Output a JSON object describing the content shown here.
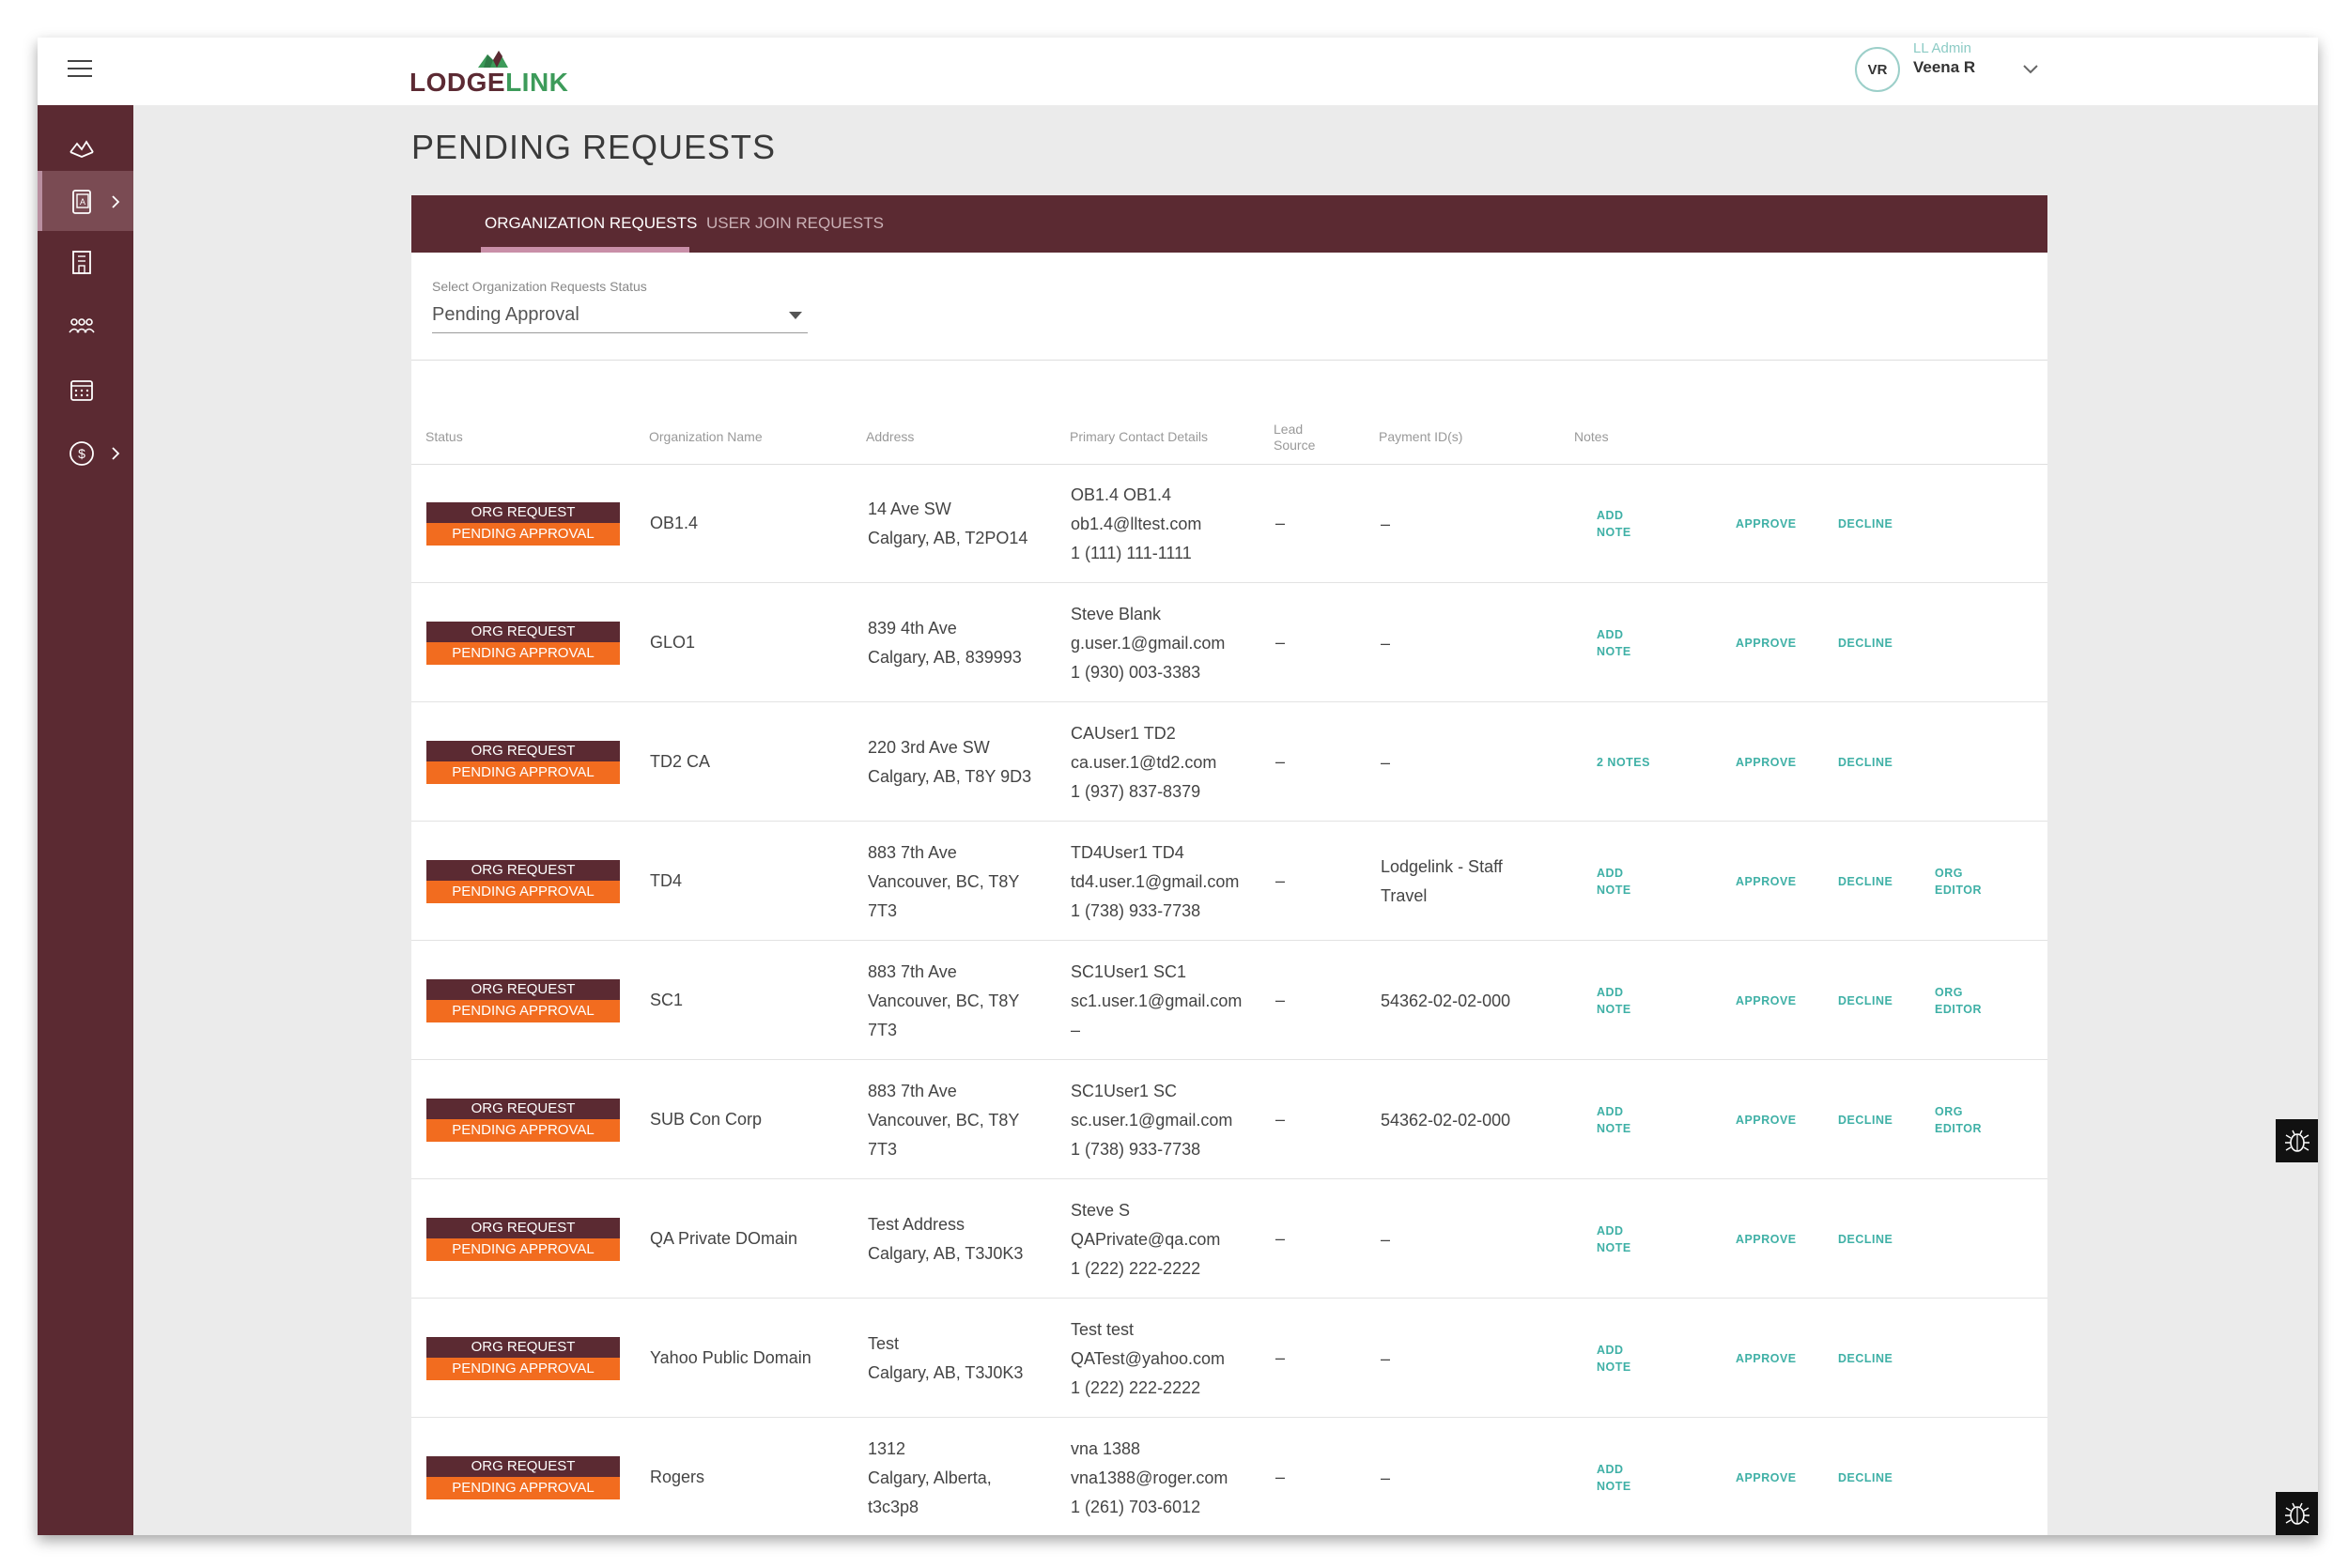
{
  "header": {
    "logo_part1": "LODGE",
    "logo_part2": "LINK",
    "user_initials": "VR",
    "user_role": "LL Admin",
    "user_name": "Veena R"
  },
  "page": {
    "title": "PENDING REQUESTS"
  },
  "tabs": [
    {
      "label": "ORGANIZATION REQUESTS",
      "active": true
    },
    {
      "label": "USER JOIN REQUESTS",
      "active": false
    }
  ],
  "filter": {
    "label": "Select Organization Requests Status",
    "value": "Pending Approval"
  },
  "columns": {
    "status": "Status",
    "org_name": "Organization Name",
    "address": "Address",
    "contact": "Primary Contact Details",
    "lead_source_1": "Lead",
    "lead_source_2": "Source",
    "payment": "Payment ID(s)",
    "notes": "Notes"
  },
  "rows": [
    {
      "status1": "ORG REQUEST",
      "status2": "PENDING APPROVAL",
      "org": "OB1.4",
      "addr": [
        "14 Ave SW",
        "Calgary, AB, T2PO14"
      ],
      "contact": [
        "OB1.4 OB1.4",
        "ob1.4@lltest.com",
        "1 (111) 111-1111"
      ],
      "lead": "–",
      "payment": [
        "–"
      ],
      "note": [
        "ADD",
        "NOTE"
      ],
      "approve": "APPROVE",
      "decline": "DECLINE",
      "editor": []
    },
    {
      "status1": "ORG REQUEST",
      "status2": "PENDING APPROVAL",
      "org": "GLO1",
      "addr": [
        "839 4th Ave",
        "Calgary, AB, 839993"
      ],
      "contact": [
        "Steve Blank",
        "g.user.1@gmail.com",
        "1 (930) 003-3383"
      ],
      "lead": "–",
      "payment": [
        "–"
      ],
      "note": [
        "ADD",
        "NOTE"
      ],
      "approve": "APPROVE",
      "decline": "DECLINE",
      "editor": []
    },
    {
      "status1": "ORG REQUEST",
      "status2": "PENDING APPROVAL",
      "org": "TD2 CA",
      "addr": [
        "220 3rd Ave SW",
        "Calgary, AB, T8Y 9D3"
      ],
      "contact": [
        "CAUser1 TD2",
        "ca.user.1@td2.com",
        "1 (937) 837-8379"
      ],
      "lead": "–",
      "payment": [
        "–"
      ],
      "note": [
        "2 NOTES"
      ],
      "approve": "APPROVE",
      "decline": "DECLINE",
      "editor": []
    },
    {
      "status1": "ORG REQUEST",
      "status2": "PENDING APPROVAL",
      "org": "TD4",
      "addr": [
        "883 7th Ave",
        "Vancouver, BC, T8Y",
        "7T3"
      ],
      "contact": [
        "TD4User1 TD4",
        "td4.user.1@gmail.com",
        "1 (738) 933-7738"
      ],
      "lead": "–",
      "payment": [
        "Lodgelink - Staff",
        "Travel"
      ],
      "note": [
        "ADD",
        "NOTE"
      ],
      "approve": "APPROVE",
      "decline": "DECLINE",
      "editor": [
        "ORG",
        "EDITOR"
      ]
    },
    {
      "status1": "ORG REQUEST",
      "status2": "PENDING APPROVAL",
      "org": "SC1",
      "addr": [
        "883 7th Ave",
        "Vancouver, BC, T8Y",
        "7T3"
      ],
      "contact": [
        "SC1User1 SC1",
        "sc1.user.1@gmail.com",
        "–"
      ],
      "lead": "–",
      "payment": [
        "54362-02-02-000"
      ],
      "note": [
        "ADD",
        "NOTE"
      ],
      "approve": "APPROVE",
      "decline": "DECLINE",
      "editor": [
        "ORG",
        "EDITOR"
      ]
    },
    {
      "status1": "ORG REQUEST",
      "status2": "PENDING APPROVAL",
      "org": "SUB Con Corp",
      "addr": [
        "883 7th Ave",
        "Vancouver, BC, T8Y",
        "7T3"
      ],
      "contact": [
        "SC1User1 SC",
        "sc.user.1@gmail.com",
        "1 (738) 933-7738"
      ],
      "lead": "–",
      "payment": [
        "54362-02-02-000"
      ],
      "note": [
        "ADD",
        "NOTE"
      ],
      "approve": "APPROVE",
      "decline": "DECLINE",
      "editor": [
        "ORG",
        "EDITOR"
      ]
    },
    {
      "status1": "ORG REQUEST",
      "status2": "PENDING APPROVAL",
      "org": "QA Private DOmain",
      "addr": [
        "Test Address",
        "Calgary, AB, T3J0K3"
      ],
      "contact": [
        "Steve S",
        "QAPrivate@qa.com",
        "1 (222) 222-2222"
      ],
      "lead": "–",
      "payment": [
        "–"
      ],
      "note": [
        "ADD",
        "NOTE"
      ],
      "approve": "APPROVE",
      "decline": "DECLINE",
      "editor": []
    },
    {
      "status1": "ORG REQUEST",
      "status2": "PENDING APPROVAL",
      "org": "Yahoo Public Domain",
      "addr": [
        "Test",
        "Calgary, AB, T3J0K3"
      ],
      "contact": [
        "Test test",
        "QATest@yahoo.com",
        "1 (222) 222-2222"
      ],
      "lead": "–",
      "payment": [
        "–"
      ],
      "note": [
        "ADD",
        "NOTE"
      ],
      "approve": "APPROVE",
      "decline": "DECLINE",
      "editor": []
    },
    {
      "status1": "ORG REQUEST",
      "status2": "PENDING APPROVAL",
      "org": "Rogers",
      "addr": [
        "1312",
        "Calgary, Alberta,",
        "t3c3p8"
      ],
      "contact": [
        "vna 1388",
        "vna1388@roger.com",
        "1 (261) 703-6012"
      ],
      "lead": "–",
      "payment": [
        "–"
      ],
      "note": [
        "ADD",
        "NOTE"
      ],
      "approve": "APPROVE",
      "decline": "DECLINE",
      "editor": []
    }
  ],
  "sidebar": {
    "icons": [
      "lodge-icon",
      "requests-icon",
      "building-icon",
      "users-icon",
      "calendar-icon",
      "billing-icon"
    ]
  },
  "colors": {
    "brand_maroon": "#5b2a32",
    "accent_teal": "#3fb0a6",
    "pending_orange": "#f26c1f",
    "logo_green": "#3d9b5a"
  }
}
